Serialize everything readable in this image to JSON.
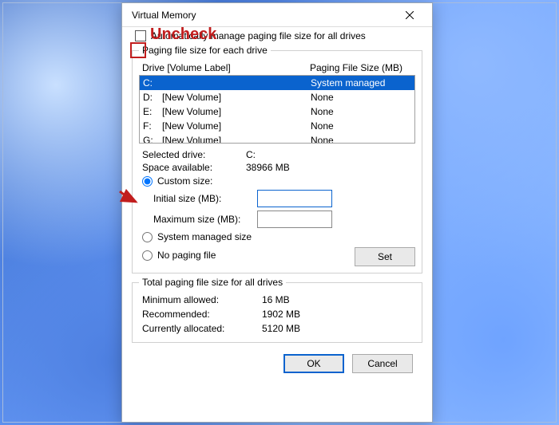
{
  "annotation": {
    "uncheck": "Uncheck"
  },
  "dialog": {
    "title": "Virtual Memory",
    "auto_manage": "Automatically manage paging file size for all drives",
    "fs_each": {
      "legend": "Paging file size for each drive",
      "head_drive": "Drive  [Volume Label]",
      "head_size": "Paging File Size (MB)",
      "rows": [
        {
          "letter": "C:",
          "label": "",
          "size": "System managed",
          "selected": true
        },
        {
          "letter": "D:",
          "label": "[New Volume]",
          "size": "None"
        },
        {
          "letter": "E:",
          "label": "[New Volume]",
          "size": "None"
        },
        {
          "letter": "F:",
          "label": "[New Volume]",
          "size": "None"
        },
        {
          "letter": "G:",
          "label": "[New Volume]",
          "size": "None"
        }
      ],
      "selected_drive_label": "Selected drive:",
      "selected_drive_value": "C:",
      "space_label": "Space available:",
      "space_value": "38966 MB",
      "custom_size": "Custom size:",
      "initial_label": "Initial size (MB):",
      "initial_value": "",
      "max_label": "Maximum size (MB):",
      "max_value": "",
      "system_managed": "System managed size",
      "no_paging": "No paging file",
      "set": "Set"
    },
    "totals": {
      "legend": "Total paging file size for all drives",
      "min_label": "Minimum allowed:",
      "min_value": "16 MB",
      "rec_label": "Recommended:",
      "rec_value": "1902 MB",
      "cur_label": "Currently allocated:",
      "cur_value": "5120 MB"
    },
    "ok": "OK",
    "cancel": "Cancel"
  }
}
